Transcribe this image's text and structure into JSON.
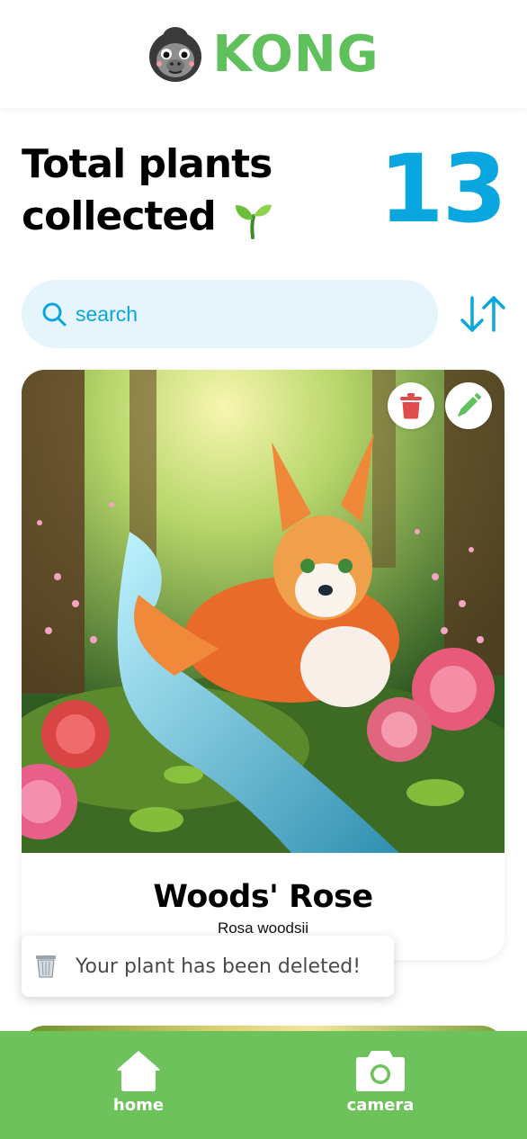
{
  "header": {
    "logo_text": "KONG",
    "logo_icon": "gorilla-icon"
  },
  "stats": {
    "title_line1": "Total plants",
    "title_line2": "collected",
    "count": "13",
    "emoji_icon": "sprout-icon"
  },
  "search": {
    "placeholder": "search",
    "value": "",
    "sort_icon": "sort-arrows-icon"
  },
  "plants": [
    {
      "name": "Woods' Rose",
      "scientific_name": "Rosa woodsii",
      "image": "fox-in-rose-forest-illustration"
    }
  ],
  "toast": {
    "icon": "wastebasket-icon",
    "message": "Your plant has been deleted!"
  },
  "nav": {
    "home_label": "home",
    "camera_label": "camera"
  },
  "colors": {
    "brand_green": "#5fc05c",
    "nav_green": "#6dc25c",
    "accent_blue": "#0aa6df",
    "delete_red": "#e04b4b"
  }
}
